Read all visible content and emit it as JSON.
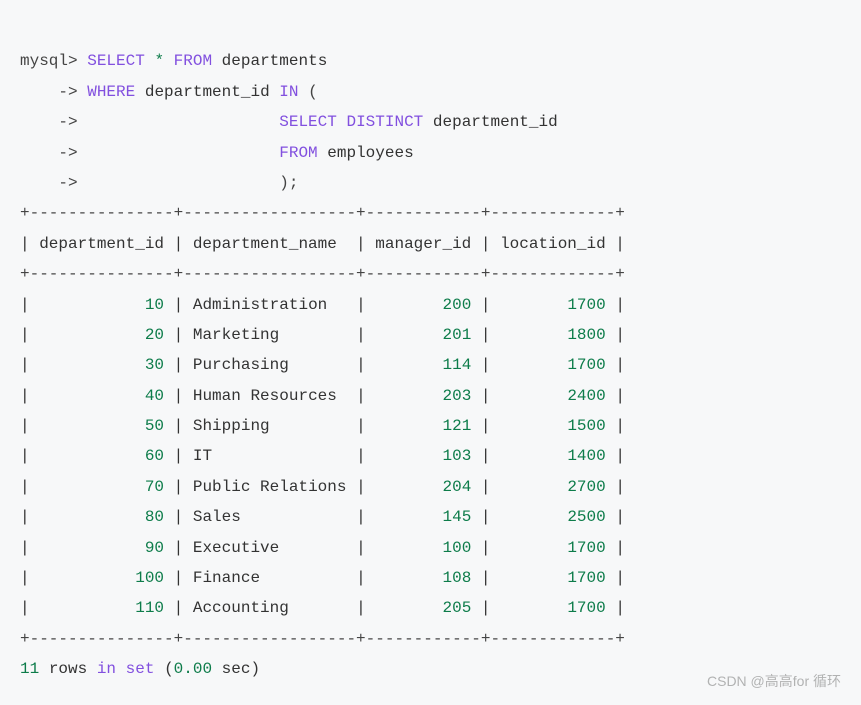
{
  "query": {
    "line1_prompt": "mysql>",
    "line1_kw1": "SELECT",
    "line1_star": "*",
    "line1_kw2": "FROM",
    "line1_ident": "departments",
    "line2_prompt": "    ->",
    "line2_kw": "WHERE",
    "line2_ident": "department_id",
    "line2_kw2": "IN",
    "line2_punct": "(",
    "line3_prompt": "    ->",
    "line3_kw": "SELECT DISTINCT",
    "line3_ident": "department_id",
    "line4_prompt": "    ->",
    "line4_kw": "FROM",
    "line4_ident": "employees",
    "line5_prompt": "    ->",
    "line5_punct": ");"
  },
  "table": {
    "border_top": "+---------------+------------------+------------+-------------+",
    "header_row": "| department_id | department_name  | manager_id | location_id |",
    "border_mid": "+---------------+------------------+------------+-------------+",
    "rows": [
      {
        "department_id": "10",
        "department_name": "Administration  ",
        "manager_id": "200",
        "location_id": "1700"
      },
      {
        "department_id": "20",
        "department_name": "Marketing       ",
        "manager_id": "201",
        "location_id": "1800"
      },
      {
        "department_id": "30",
        "department_name": "Purchasing      ",
        "manager_id": "114",
        "location_id": "1700"
      },
      {
        "department_id": "40",
        "department_name": "Human Resources ",
        "manager_id": "203",
        "location_id": "2400"
      },
      {
        "department_id": "50",
        "department_name": "Shipping        ",
        "manager_id": "121",
        "location_id": "1500"
      },
      {
        "department_id": "60",
        "department_name": "IT              ",
        "manager_id": "103",
        "location_id": "1400"
      },
      {
        "department_id": "70",
        "department_name": "Public Relations",
        "manager_id": "204",
        "location_id": "2700"
      },
      {
        "department_id": "80",
        "department_name": "Sales           ",
        "manager_id": "145",
        "location_id": "2500"
      },
      {
        "department_id": "90",
        "department_name": "Executive       ",
        "manager_id": "100",
        "location_id": "1700"
      },
      {
        "department_id": "100",
        "department_name": "Finance         ",
        "manager_id": "108",
        "location_id": "1700"
      },
      {
        "department_id": "110",
        "department_name": "Accounting      ",
        "manager_id": "205",
        "location_id": "1700"
      }
    ],
    "border_bot": "+---------------+------------------+------------+-------------+"
  },
  "status": {
    "count": "11",
    "text_rows": "rows",
    "kw_in": "in",
    "kw_set": "set",
    "time_open": "(",
    "time_val": "0.00",
    "time_close": " sec)"
  },
  "watermark": "CSDN @高高for 循环"
}
